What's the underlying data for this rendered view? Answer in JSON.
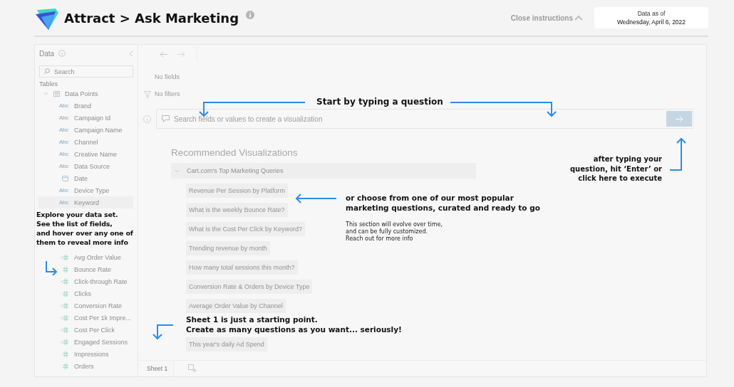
{
  "header": {
    "title": "Attract > Ask Marketing",
    "close_instructions": "Close instructions",
    "data_as_of": {
      "label": "Data as of",
      "date": "Wednesday, April 6, 2022"
    }
  },
  "sidebar": {
    "title": "Data",
    "search": {
      "placeholder": "Search"
    },
    "section": "Tables",
    "table": {
      "name": "Data Points",
      "expanded": true
    },
    "rows": [
      {
        "kind": "text",
        "badge": "Abc",
        "name": "Brand",
        "highlighted": false
      },
      {
        "kind": "text",
        "badge": "Abc",
        "name": "Campaign Id",
        "highlighted": false
      },
      {
        "kind": "text",
        "badge": "Abc",
        "name": "Campaign Name",
        "highlighted": false
      },
      {
        "kind": "text",
        "badge": "Abc",
        "name": "Channel",
        "highlighted": false
      },
      {
        "kind": "text",
        "badge": "Abc",
        "name": "Creative Name",
        "highlighted": false
      },
      {
        "kind": "text",
        "badge": "Abc",
        "name": "Data Source",
        "highlighted": false
      },
      {
        "kind": "date",
        "name": "Date",
        "highlighted": false
      },
      {
        "kind": "text",
        "badge": "Abc",
        "name": "Device Type",
        "highlighted": false
      },
      {
        "kind": "text",
        "badge": "Abc",
        "name": "Keyword",
        "highlighted": true
      },
      {
        "kind": "tip",
        "text": "Explore your data set.\nSee the list of fields,\nand hover over any one of\nthem to reveal more info"
      },
      {
        "kind": "calculated",
        "name": "Avg Order Value",
        "highlighted": false
      },
      {
        "kind": "measure",
        "name": "Bounce Rate",
        "highlighted": false
      },
      {
        "kind": "calculated",
        "name": "Click-through Rate",
        "highlighted": false
      },
      {
        "kind": "measure",
        "name": "Clicks",
        "highlighted": false
      },
      {
        "kind": "calculated",
        "name": "Conversion Rate",
        "highlighted": false
      },
      {
        "kind": "calculated",
        "name": "Cost Per 1k Impre...",
        "highlighted": false
      },
      {
        "kind": "calculated",
        "name": "Cost Per Click",
        "highlighted": false
      },
      {
        "kind": "calculated",
        "name": "Engaged Sessions",
        "highlighted": false
      },
      {
        "kind": "measure",
        "name": "Impressions",
        "highlighted": false
      },
      {
        "kind": "measure",
        "name": "Orders",
        "highlighted": false
      }
    ]
  },
  "main": {
    "fields_shelf": "No fields",
    "filters_shelf": "No filters",
    "search": {
      "placeholder": "Search fields or values to create a visualization"
    },
    "recommended": {
      "title": "Recommended Visualizations",
      "group": "Cart.com's Top Marketing Queries",
      "expanded": true,
      "items": [
        {
          "kind": "query",
          "text": "Revenue Per Session by Platform"
        },
        {
          "kind": "query",
          "text": "What is the weekly Bounce Rate?"
        },
        {
          "kind": "query",
          "text": "What is the Cost Per Click by Keyword?"
        },
        {
          "kind": "query",
          "text": "Trending revenue by month"
        },
        {
          "kind": "query",
          "text": "How many total sessions this month?"
        },
        {
          "kind": "query",
          "text": "Conversion Rate & Orders by Device Type"
        },
        {
          "kind": "query",
          "text": "Average Order Value by Channel"
        },
        {
          "kind": "tip",
          "text": "Sheet 1 is just a starting point.\nCreate as many questions as you want... seriously!"
        },
        {
          "kind": "query",
          "text": "This year's daily Ad Spend"
        }
      ]
    },
    "sheets": [
      {
        "label": "Sheet 1",
        "selected": true
      }
    ]
  },
  "tips": {
    "start": "Start by typing a question",
    "choose": "or choose from one of our most popular\nmarketing questions, curated and ready to go",
    "section_note": "This section will evolve over time,\nand can be fully customized.\nReach out for more info",
    "execute": "after typing your\nquestion, hit ‘Enter’ or\nclick here to execute"
  }
}
